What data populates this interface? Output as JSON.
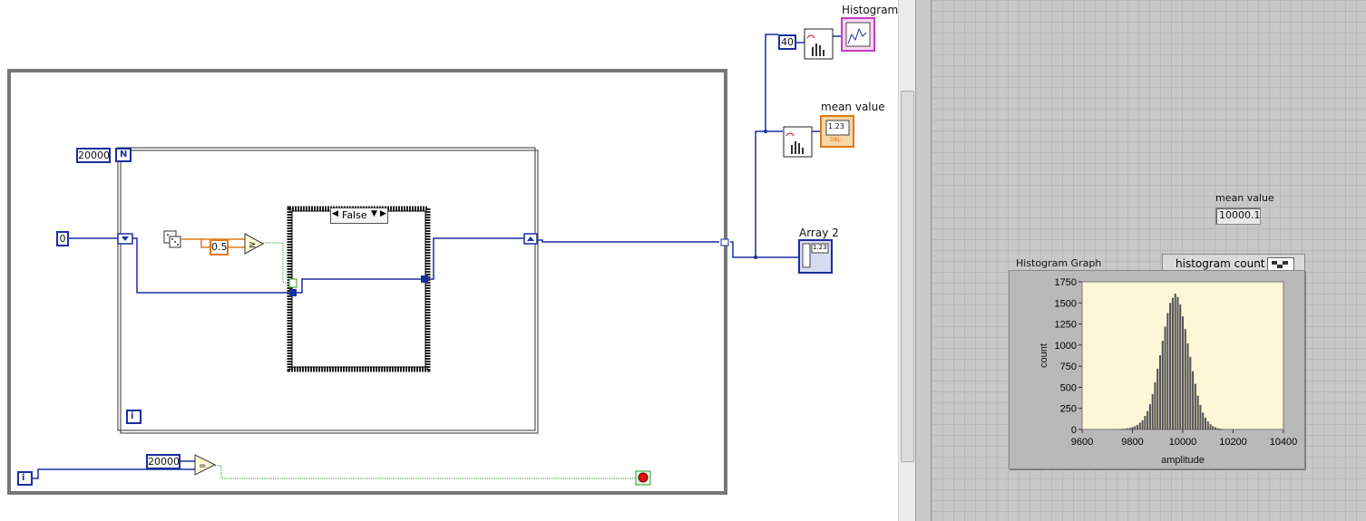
{
  "block_diagram": {
    "loop_count": "20000",
    "shift_init": "0",
    "threshold": "0.5",
    "case_selector": "False",
    "compare_value": "20000",
    "bins_const": "40",
    "labels": {
      "histogram_graph": "Histogram G",
      "mean_value": "mean value",
      "array2": "Array 2"
    },
    "terminals": {
      "N": "N",
      "i_for": "i",
      "i_while": "i",
      "dbl": "1.23",
      "dbl_sub": "DBL",
      "arr": "1.23"
    }
  },
  "front_panel": {
    "mean_value_label": "mean value",
    "mean_value": "10000.1",
    "graph_title": "Histogram Graph",
    "legend_label": "histogram count",
    "colors": {
      "plot_bg": "#fdf6d7",
      "bar_fill": "#555555"
    }
  },
  "chart_data": {
    "type": "bar",
    "title": "Histogram Graph",
    "xlabel": "amplitude",
    "ylabel": "count",
    "xlim": [
      9600,
      10400
    ],
    "ylim": [
      0,
      1750
    ],
    "xticks": [
      "9600",
      "9800",
      "10000",
      "10200",
      "10400"
    ],
    "yticks": [
      "0",
      "250",
      "500",
      "750",
      "1000",
      "1250",
      "1500",
      "1750"
    ],
    "series": [
      {
        "name": "histogram count",
        "x": [
          9720,
          9730,
          9740,
          9750,
          9760,
          9770,
          9780,
          9790,
          9800,
          9810,
          9820,
          9830,
          9840,
          9850,
          9860,
          9870,
          9880,
          9890,
          9900,
          9910,
          9920,
          9930,
          9940,
          9950,
          9960,
          9970,
          9980,
          9990,
          10000,
          10010,
          10020,
          10030,
          10040,
          10050,
          10060,
          10070,
          10080,
          10090,
          10100,
          10110,
          10120,
          10130,
          10140,
          10150,
          10160,
          10170,
          10180,
          10190,
          10200,
          10210,
          10220,
          10230,
          10240,
          10250,
          10260,
          10270,
          10280
        ],
        "values": [
          2,
          3,
          4,
          6,
          8,
          10,
          14,
          20,
          28,
          38,
          55,
          80,
          110,
          160,
          220,
          300,
          420,
          560,
          720,
          880,
          1050,
          1220,
          1380,
          1500,
          1560,
          1610,
          1570,
          1480,
          1340,
          1190,
          1020,
          860,
          690,
          540,
          400,
          290,
          200,
          140,
          95,
          60,
          40,
          26,
          16,
          10,
          6,
          4,
          3,
          2,
          1,
          1,
          0,
          0,
          0,
          0,
          0,
          0,
          0
        ]
      }
    ]
  }
}
